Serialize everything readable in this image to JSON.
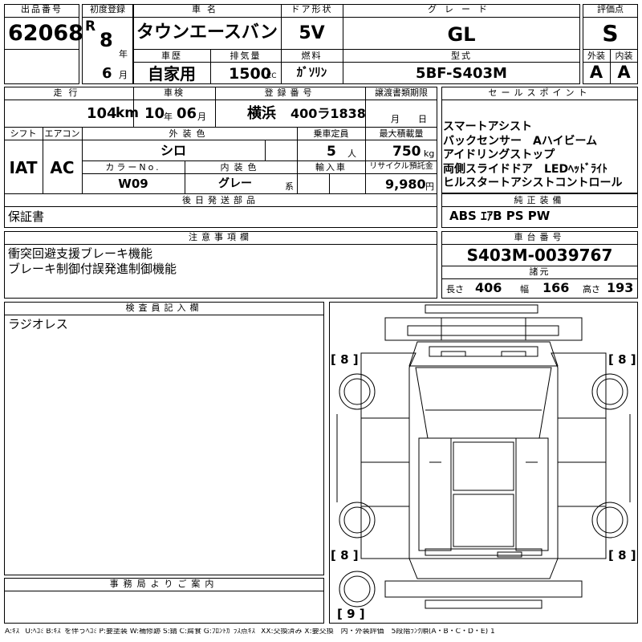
{
  "header": {
    "lot_label": "出品番号",
    "lot_no": "62068",
    "first_reg_label": "初度登録",
    "era": "R",
    "year": "8",
    "year_unit": "年",
    "month": "6",
    "month_unit": "月",
    "name_label": "車名",
    "name": "タウンエースバン",
    "door_label": "ドア形状",
    "door": "5V",
    "grade_label": "グレード",
    "grade": "GL",
    "rating_label": "評価点",
    "rating": "S",
    "history_label": "車歴",
    "history": "自家用",
    "disp_label": "排気量",
    "disp": "1500",
    "disp_unit": "CC",
    "fuel_label": "燃料",
    "fuel": "ｶﾞｿﾘﾝ",
    "model_label": "型式",
    "model": "5BF-S403M",
    "ext_label": "外装",
    "ext_grade": "A",
    "int_label": "内装",
    "int_grade": "A"
  },
  "row2": {
    "mileage_label": "走行",
    "mileage": "104",
    "mileage_unit": "km",
    "inspect_label": "車検",
    "inspect_year": "10",
    "inspect_year_unit": "年",
    "inspect_month": "06",
    "inspect_month_unit": "月",
    "reg_label": "登録番号",
    "reg_area": "横浜",
    "reg_no": "400ラ1838",
    "transfer_label": "譲渡書類期限",
    "transfer_month_unit": "月",
    "transfer_day_unit": "日",
    "sales_label": "セールスポイント",
    "sales_points": [
      "スマートアシスト",
      "バックセンサー　Aハイビーム",
      "アイドリングストップ",
      "両側スライドドア　LEDﾍｯﾄﾞﾗｲﾄ",
      "ヒルスタートアシストコントロール"
    ]
  },
  "row3": {
    "shift_label": "シフト",
    "shift": "IAT",
    "ac_label": "エアコン",
    "ac": "AC",
    "color_label": "外装色",
    "color": "シロ",
    "capacity_label": "乗車定員",
    "capacity": "5",
    "capacity_unit": "人",
    "load_label": "最大積載量",
    "load": "750",
    "load_unit": "kg",
    "color_no_label": "カラーNo.",
    "color_no": "W09",
    "int_color_label": "内装色",
    "int_color": "グレー",
    "int_color_unit": "系",
    "import_label": "輸入車",
    "recycle_label": "リサイクル預託金",
    "recycle": "9,980",
    "recycle_unit": "円"
  },
  "later": {
    "label": "後日発送部品",
    "value": "保証書"
  },
  "genuine": {
    "label": "純正装備",
    "value": "ABS ｴｱB PS PW"
  },
  "notes": {
    "label": "注意事項欄",
    "lines": [
      "衝突回避支援ブレーキ機能",
      "ブレーキ制御付誤発進制御機能"
    ]
  },
  "chassis": {
    "label": "車台番号",
    "value": "S403M-0039767"
  },
  "dims": {
    "label": "諸元",
    "length_label": "長さ",
    "length": "406",
    "width_label": "幅",
    "width": "166",
    "height_label": "高さ",
    "height": "193"
  },
  "inspector": {
    "label": "検査員記入欄",
    "value": "ラジオレス"
  },
  "office": {
    "label": "事務局よりご案内"
  },
  "diagram": {
    "tire_fl": "8",
    "tire_fr": "8",
    "tire_rl": "8",
    "tire_rr": "8",
    "spare": "9"
  },
  "legend": "A:ｷｽﾞ U:ﾍｺﾐ B:ｷｽﾞを伴うﾍｺﾐ P:要塗装 W:補修跡 S:錆 C:腐食 G:ﾌﾛﾝﾄｶﾞﾗｽ点ｷｽﾞ XX:交換済み X:要交換　内・外装評価　5段階ﾗﾝｸ順(A・B・C・D・E) 1"
}
